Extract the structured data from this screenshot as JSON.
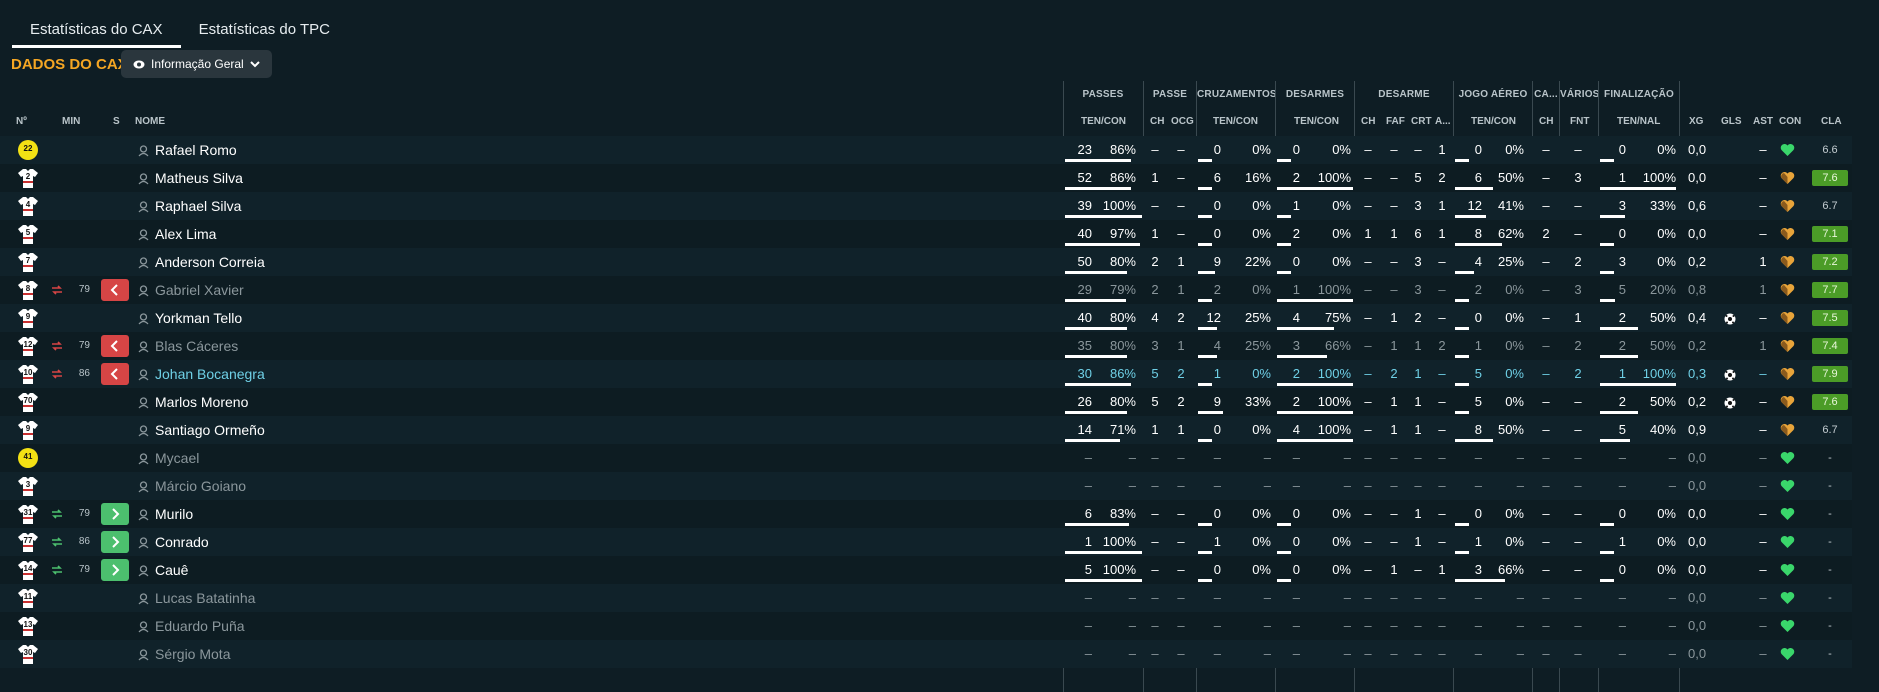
{
  "tabs": [
    {
      "label": "Estatísticas do CAX",
      "active": true
    },
    {
      "label": "Estatísticas do TPC",
      "active": false
    }
  ],
  "title": "DADOS DO CAX",
  "dropdown": {
    "label": "Informação Geral",
    "icon": "eye-icon"
  },
  "group_headers": [
    "PASSES",
    "PASSE",
    "CRUZAMENTOS",
    "DESARMES",
    "DESARME",
    "JOGO AÉREO",
    "CA...",
    "VÁRIOS",
    "FINALIZAÇÃO"
  ],
  "col_headers": {
    "num": "Nº",
    "min": "MIN",
    "s": "S",
    "name": "NOME",
    "passes": "TEN/CON",
    "passe_ch": "CH",
    "passe_ocg": "OCG",
    "cruz": "TEN/CON",
    "desarmes": "TEN/CON",
    "des_ch": "CH",
    "des_faf": "FAF",
    "des_crt": "CRT",
    "des_a": "A...",
    "aereo": "TEN/CON",
    "ca_ch": "CH",
    "varios": "FNT",
    "final": "TEN/NAL",
    "xg": "XG",
    "gls": "GLS",
    "ast": "AST",
    "con": "CON",
    "cla": "CLA"
  },
  "colors": {
    "accent": "#f5a623",
    "sub_out": "#d64545",
    "sub_in": "#4cbf6e",
    "rating": "#4b9c27",
    "heart_green": "#3ad66b",
    "heart_orange": "#e8a43a"
  },
  "players": [
    {
      "num": "22",
      "kit": "yellow",
      "min": "",
      "sub": "",
      "name": "Rafael Romo",
      "style": "bright",
      "p": [
        "23",
        "86%"
      ],
      "pb": 0.86,
      "ch": "–",
      "ocg": "–",
      "cz": [
        "0",
        "0%"
      ],
      "czb": 0,
      "ds": [
        "0",
        "0%"
      ],
      "dsb": 0,
      "dch": "–",
      "faf": "–",
      "crt": "–",
      "a": "1",
      "ae": [
        "0",
        "0%"
      ],
      "aeb": 0,
      "cach": "–",
      "fnt": "–",
      "fn": [
        "0",
        "0%"
      ],
      "fnb": 0,
      "xg": "0,0",
      "gls": "",
      "ast": "–",
      "heart": "green",
      "cla": "6.6",
      "clag": false
    },
    {
      "num": "2",
      "kit": "white",
      "min": "",
      "sub": "",
      "name": "Matheus Silva",
      "style": "bright",
      "p": [
        "52",
        "86%"
      ],
      "pb": 0.86,
      "ch": "1",
      "ocg": "–",
      "cz": [
        "6",
        "16%"
      ],
      "czb": 0.16,
      "ds": [
        "2",
        "100%"
      ],
      "dsb": 1,
      "dch": "–",
      "faf": "–",
      "crt": "5",
      "a": "2",
      "ae": [
        "6",
        "50%"
      ],
      "aeb": 0.5,
      "cach": "–",
      "fnt": "3",
      "fn": [
        "1",
        "100%"
      ],
      "fnb": 1,
      "xg": "0,0",
      "gls": "",
      "ast": "–",
      "heart": "orange",
      "cla": "7.6",
      "clag": true
    },
    {
      "num": "4",
      "kit": "white",
      "min": "",
      "sub": "",
      "name": "Raphael Silva",
      "style": "bright",
      "p": [
        "39",
        "100%"
      ],
      "pb": 1,
      "ch": "–",
      "ocg": "–",
      "cz": [
        "0",
        "0%"
      ],
      "czb": 0,
      "ds": [
        "1",
        "0%"
      ],
      "dsb": 0,
      "dch": "–",
      "faf": "–",
      "crt": "3",
      "a": "1",
      "ae": [
        "12",
        "41%"
      ],
      "aeb": 0.41,
      "cach": "–",
      "fnt": "–",
      "fn": [
        "3",
        "33%"
      ],
      "fnb": 0.33,
      "xg": "0,6",
      "gls": "",
      "ast": "–",
      "heart": "orange",
      "cla": "6.7",
      "clag": false
    },
    {
      "num": "5",
      "kit": "white",
      "min": "",
      "sub": "",
      "name": "Alex Lima",
      "style": "bright",
      "p": [
        "40",
        "97%"
      ],
      "pb": 0.97,
      "ch": "1",
      "ocg": "–",
      "cz": [
        "0",
        "0%"
      ],
      "czb": 0,
      "ds": [
        "2",
        "0%"
      ],
      "dsb": 0,
      "dch": "1",
      "faf": "1",
      "crt": "6",
      "a": "1",
      "ae": [
        "8",
        "62%"
      ],
      "aeb": 0.62,
      "cach": "2",
      "fnt": "–",
      "fn": [
        "0",
        "0%"
      ],
      "fnb": 0,
      "xg": "0,0",
      "gls": "",
      "ast": "–",
      "heart": "orange",
      "cla": "7.1",
      "clag": true
    },
    {
      "num": "7",
      "kit": "white",
      "min": "",
      "sub": "",
      "name": "Anderson Correia",
      "style": "bright",
      "p": [
        "50",
        "80%"
      ],
      "pb": 0.8,
      "ch": "2",
      "ocg": "1",
      "cz": [
        "9",
        "22%"
      ],
      "czb": 0.22,
      "ds": [
        "0",
        "0%"
      ],
      "dsb": 0,
      "dch": "–",
      "faf": "–",
      "crt": "3",
      "a": "–",
      "ae": [
        "4",
        "25%"
      ],
      "aeb": 0.25,
      "cach": "–",
      "fnt": "2",
      "fn": [
        "3",
        "0%"
      ],
      "fnb": 0,
      "xg": "0,2",
      "gls": "",
      "ast": "1",
      "heart": "orange",
      "cla": "7.2",
      "clag": true
    },
    {
      "num": "8",
      "kit": "white",
      "min": "79",
      "sub": "out",
      "name": "Gabriel Xavier",
      "style": "dim",
      "p": [
        "29",
        "79%"
      ],
      "pb": 0.79,
      "ch": "2",
      "ocg": "1",
      "cz": [
        "2",
        "0%"
      ],
      "czb": 0,
      "ds": [
        "1",
        "100%"
      ],
      "dsb": 1,
      "dch": "–",
      "faf": "–",
      "crt": "3",
      "a": "–",
      "ae": [
        "2",
        "0%"
      ],
      "aeb": 0,
      "cach": "–",
      "fnt": "3",
      "fn": [
        "5",
        "20%"
      ],
      "fnb": 0.2,
      "xg": "0,8",
      "gls": "",
      "ast": "1",
      "heart": "orange",
      "cla": "7.7",
      "clag": true
    },
    {
      "num": "9",
      "kit": "white",
      "min": "",
      "sub": "",
      "name": "Yorkman Tello",
      "style": "bright",
      "p": [
        "40",
        "80%"
      ],
      "pb": 0.8,
      "ch": "4",
      "ocg": "2",
      "cz": [
        "12",
        "25%"
      ],
      "czb": 0.25,
      "ds": [
        "4",
        "75%"
      ],
      "dsb": 0.75,
      "dch": "–",
      "faf": "1",
      "crt": "2",
      "a": "–",
      "ae": [
        "0",
        "0%"
      ],
      "aeb": 0,
      "cach": "–",
      "fnt": "1",
      "fn": [
        "2",
        "50%"
      ],
      "fnb": 0.5,
      "xg": "0,4",
      "gls": "ball",
      "ast": "–",
      "heart": "orange",
      "cla": "7.5",
      "clag": true
    },
    {
      "num": "12",
      "kit": "white",
      "min": "79",
      "sub": "out",
      "name": "Blas Cáceres",
      "style": "dim",
      "p": [
        "35",
        "80%"
      ],
      "pb": 0.8,
      "ch": "3",
      "ocg": "1",
      "cz": [
        "4",
        "25%"
      ],
      "czb": 0.25,
      "ds": [
        "3",
        "66%"
      ],
      "dsb": 0.66,
      "dch": "–",
      "faf": "1",
      "crt": "1",
      "a": "2",
      "ae": [
        "1",
        "0%"
      ],
      "aeb": 0,
      "cach": "–",
      "fnt": "2",
      "fn": [
        "2",
        "50%"
      ],
      "fnb": 0.5,
      "xg": "0,2",
      "gls": "",
      "ast": "1",
      "heart": "orange",
      "cla": "7.4",
      "clag": true
    },
    {
      "num": "10",
      "kit": "white",
      "min": "86",
      "sub": "out",
      "name": "Johan Bocanegra",
      "style": "sel",
      "p": [
        "30",
        "86%"
      ],
      "pb": 0.86,
      "ch": "5",
      "ocg": "2",
      "cz": [
        "1",
        "0%"
      ],
      "czb": 0,
      "ds": [
        "2",
        "100%"
      ],
      "dsb": 1,
      "dch": "–",
      "faf": "2",
      "crt": "1",
      "a": "–",
      "ae": [
        "5",
        "0%"
      ],
      "aeb": 0,
      "cach": "–",
      "fnt": "2",
      "fn": [
        "1",
        "100%"
      ],
      "fnb": 1,
      "xg": "0,3",
      "gls": "ball",
      "ast": "–",
      "heart": "orange",
      "cla": "7.9",
      "clag": true
    },
    {
      "num": "70",
      "kit": "white",
      "min": "",
      "sub": "",
      "name": "Marlos Moreno",
      "style": "bright",
      "p": [
        "26",
        "80%"
      ],
      "pb": 0.8,
      "ch": "5",
      "ocg": "2",
      "cz": [
        "9",
        "33%"
      ],
      "czb": 0.33,
      "ds": [
        "2",
        "100%"
      ],
      "dsb": 1,
      "dch": "–",
      "faf": "1",
      "crt": "1",
      "a": "–",
      "ae": [
        "5",
        "0%"
      ],
      "aeb": 0,
      "cach": "–",
      "fnt": "–",
      "fn": [
        "2",
        "50%"
      ],
      "fnb": 0.5,
      "xg": "0,2",
      "gls": "ball",
      "ast": "–",
      "heart": "orange",
      "cla": "7.6",
      "clag": true
    },
    {
      "num": "9",
      "kit": "white",
      "min": "",
      "sub": "",
      "name": "Santiago Ormeño",
      "style": "bright",
      "p": [
        "14",
        "71%"
      ],
      "pb": 0.71,
      "ch": "1",
      "ocg": "1",
      "cz": [
        "0",
        "0%"
      ],
      "czb": 0,
      "ds": [
        "4",
        "100%"
      ],
      "dsb": 1,
      "dch": "–",
      "faf": "1",
      "crt": "1",
      "a": "–",
      "ae": [
        "8",
        "50%"
      ],
      "aeb": 0.5,
      "cach": "–",
      "fnt": "–",
      "fn": [
        "5",
        "40%"
      ],
      "fnb": 0.4,
      "xg": "0,9",
      "gls": "",
      "ast": "–",
      "heart": "orange",
      "cla": "6.7",
      "clag": false
    },
    {
      "num": "41",
      "kit": "yellow",
      "min": "",
      "sub": "",
      "name": "Mycael",
      "style": "dim",
      "p": [
        "–",
        "–"
      ],
      "pb": -1,
      "ch": "–",
      "ocg": "–",
      "cz": [
        "–",
        "–"
      ],
      "czb": -1,
      "ds": [
        "–",
        "–"
      ],
      "dsb": -1,
      "dch": "–",
      "faf": "–",
      "crt": "–",
      "a": "–",
      "ae": [
        "–",
        "–"
      ],
      "aeb": -1,
      "cach": "–",
      "fnt": "–",
      "fn": [
        "–",
        "–"
      ],
      "fnb": -1,
      "xg": "0,0",
      "gls": "",
      "ast": "–",
      "heart": "green",
      "cla": "-",
      "clag": false
    },
    {
      "num": "3",
      "kit": "white",
      "min": "",
      "sub": "",
      "name": "Márcio Goiano",
      "style": "dim",
      "p": [
        "–",
        "–"
      ],
      "pb": -1,
      "ch": "–",
      "ocg": "–",
      "cz": [
        "–",
        "–"
      ],
      "czb": -1,
      "ds": [
        "–",
        "–"
      ],
      "dsb": -1,
      "dch": "–",
      "faf": "–",
      "crt": "–",
      "a": "–",
      "ae": [
        "–",
        "–"
      ],
      "aeb": -1,
      "cach": "–",
      "fnt": "–",
      "fn": [
        "–",
        "–"
      ],
      "fnb": -1,
      "xg": "0,0",
      "gls": "",
      "ast": "–",
      "heart": "green",
      "cla": "-",
      "clag": false
    },
    {
      "num": "31",
      "kit": "white",
      "min": "79",
      "sub": "in",
      "name": "Murilo",
      "style": "bright",
      "p": [
        "6",
        "83%"
      ],
      "pb": 0.83,
      "ch": "–",
      "ocg": "–",
      "cz": [
        "0",
        "0%"
      ],
      "czb": 0,
      "ds": [
        "0",
        "0%"
      ],
      "dsb": 0,
      "dch": "–",
      "faf": "–",
      "crt": "1",
      "a": "–",
      "ae": [
        "0",
        "0%"
      ],
      "aeb": 0,
      "cach": "–",
      "fnt": "–",
      "fn": [
        "0",
        "0%"
      ],
      "fnb": 0,
      "xg": "0,0",
      "gls": "",
      "ast": "–",
      "heart": "green",
      "cla": "-",
      "clag": false
    },
    {
      "num": "77",
      "kit": "white",
      "min": "86",
      "sub": "in",
      "name": "Conrado",
      "style": "bright",
      "p": [
        "1",
        "100%"
      ],
      "pb": 1,
      "ch": "–",
      "ocg": "–",
      "cz": [
        "1",
        "0%"
      ],
      "czb": 0,
      "ds": [
        "0",
        "0%"
      ],
      "dsb": 0,
      "dch": "–",
      "faf": "–",
      "crt": "1",
      "a": "–",
      "ae": [
        "1",
        "0%"
      ],
      "aeb": 0,
      "cach": "–",
      "fnt": "–",
      "fn": [
        "1",
        "0%"
      ],
      "fnb": 0,
      "xg": "0,0",
      "gls": "",
      "ast": "–",
      "heart": "green",
      "cla": "-",
      "clag": false
    },
    {
      "num": "14",
      "kit": "white",
      "min": "79",
      "sub": "in",
      "name": "Cauê",
      "style": "bright",
      "p": [
        "5",
        "100%"
      ],
      "pb": 1,
      "ch": "–",
      "ocg": "–",
      "cz": [
        "0",
        "0%"
      ],
      "czb": 0,
      "ds": [
        "0",
        "0%"
      ],
      "dsb": 0,
      "dch": "–",
      "faf": "1",
      "crt": "–",
      "a": "1",
      "ae": [
        "3",
        "66%"
      ],
      "aeb": 0.66,
      "cach": "–",
      "fnt": "–",
      "fn": [
        "0",
        "0%"
      ],
      "fnb": 0,
      "xg": "0,0",
      "gls": "",
      "ast": "–",
      "heart": "green",
      "cla": "-",
      "clag": false
    },
    {
      "num": "11",
      "kit": "white",
      "min": "",
      "sub": "",
      "name": "Lucas Batatinha",
      "style": "dim",
      "p": [
        "–",
        "–"
      ],
      "pb": -1,
      "ch": "–",
      "ocg": "–",
      "cz": [
        "–",
        "–"
      ],
      "czb": -1,
      "ds": [
        "–",
        "–"
      ],
      "dsb": -1,
      "dch": "–",
      "faf": "–",
      "crt": "–",
      "a": "–",
      "ae": [
        "–",
        "–"
      ],
      "aeb": -1,
      "cach": "–",
      "fnt": "–",
      "fn": [
        "–",
        "–"
      ],
      "fnb": -1,
      "xg": "0,0",
      "gls": "",
      "ast": "–",
      "heart": "green",
      "cla": "-",
      "clag": false
    },
    {
      "num": "13",
      "kit": "white",
      "min": "",
      "sub": "",
      "name": "Eduardo Puña",
      "style": "dim",
      "p": [
        "–",
        "–"
      ],
      "pb": -1,
      "ch": "–",
      "ocg": "–",
      "cz": [
        "–",
        "–"
      ],
      "czb": -1,
      "ds": [
        "–",
        "–"
      ],
      "dsb": -1,
      "dch": "–",
      "faf": "–",
      "crt": "–",
      "a": "–",
      "ae": [
        "–",
        "–"
      ],
      "aeb": -1,
      "cach": "–",
      "fnt": "–",
      "fn": [
        "–",
        "–"
      ],
      "fnb": -1,
      "xg": "0,0",
      "gls": "",
      "ast": "–",
      "heart": "green",
      "cla": "-",
      "clag": false
    },
    {
      "num": "30",
      "kit": "white",
      "min": "",
      "sub": "",
      "name": "Sérgio Mota",
      "style": "dim",
      "p": [
        "–",
        "–"
      ],
      "pb": -1,
      "ch": "–",
      "ocg": "–",
      "cz": [
        "–",
        "–"
      ],
      "czb": -1,
      "ds": [
        "–",
        "–"
      ],
      "dsb": -1,
      "dch": "–",
      "faf": "–",
      "crt": "–",
      "a": "–",
      "ae": [
        "–",
        "–"
      ],
      "aeb": -1,
      "cach": "–",
      "fnt": "–",
      "fn": [
        "–",
        "–"
      ],
      "fnb": -1,
      "xg": "0,0",
      "gls": "",
      "ast": "–",
      "heart": "green",
      "cla": "-",
      "clag": false
    }
  ]
}
